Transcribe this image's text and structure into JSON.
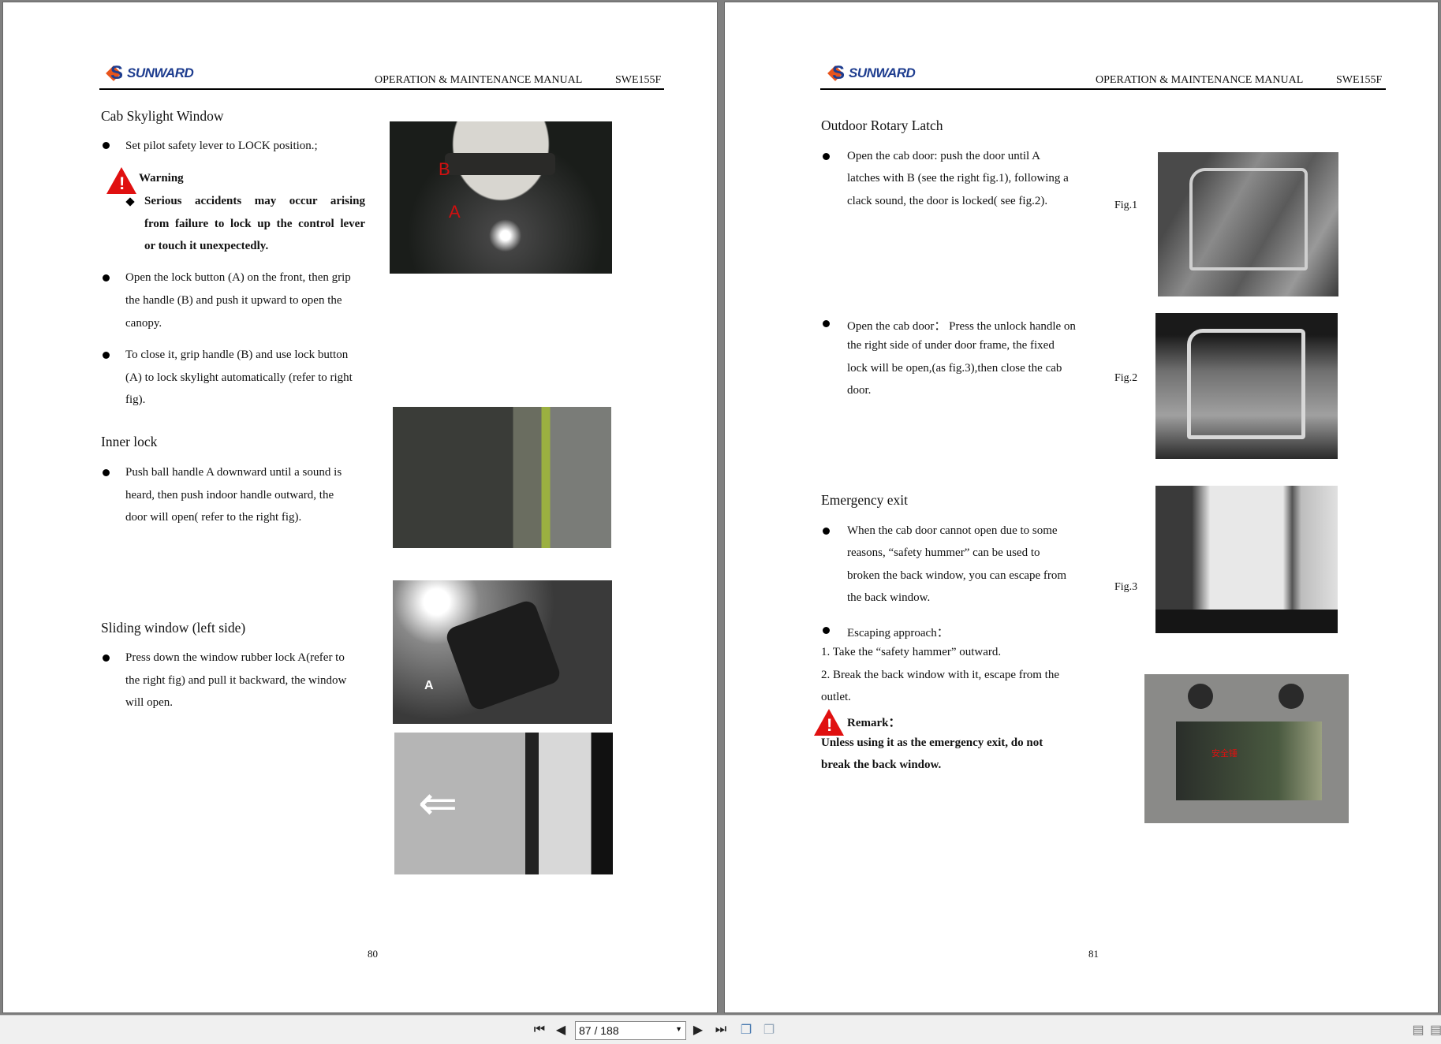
{
  "header": {
    "brand": "SUNWARD",
    "manual": "OPERATION & MAINTENANCE MANUAL",
    "model": "SWE155F"
  },
  "left": {
    "title1": "Cab Skylight Window",
    "b1": "Set pilot safety lever to LOCK position.;",
    "warning": "Warning",
    "warn_lines": [
      "Serious accidents may occur arising",
      "from failure to lock up the control lever",
      "or touch it unexpectedly."
    ],
    "b2": [
      "Open the lock button (A) on the front, then grip",
      "the handle (B) and push it upward to open the",
      "canopy."
    ],
    "b3": [
      "To close it, grip handle (B) and use lock button",
      "(A) to lock skylight automatically (refer to right",
      "fig)."
    ],
    "title2": "Inner lock",
    "b4": [
      "Push ball handle A downward until a sound is",
      "heard, then push indoor handle outward, the",
      "door will open( refer to the right fig)."
    ],
    "title3": "Sliding window (left side)",
    "b5": [
      "Press down the window rubber lock A(refer to",
      "the right fig) and pull it backward, the window",
      "will open."
    ],
    "photo_labels": {
      "a": "A",
      "b": "B"
    },
    "page_number": "80"
  },
  "right": {
    "title1": "Outdoor Rotary Latch",
    "b1": [
      "Open the cab door: push the door until A",
      "latches with B (see the right fig.1), following a",
      "clack sound, the door is locked( see fig.2)."
    ],
    "b2": [
      "Open the cab door： Press the unlock handle on",
      "the right side of under door frame, the fixed",
      "lock will be open,(as fig.3),then close the cab",
      "door."
    ],
    "title2": "Emergency exit",
    "b3": [
      "When the cab door cannot open due to some",
      "reasons, “safety hummer” can be used to",
      "broken the back window, you can escape from",
      "the back window."
    ],
    "b4": "Escaping approach：",
    "step1": "1. Take the “safety hammer” outward.",
    "step2": [
      "2. Break the back window with it, escape from the",
      "outlet."
    ],
    "remark": "Remark：",
    "remark_lines": [
      "Unless using it as the emergency exit, do not",
      "break the back window."
    ],
    "figs": [
      "Fig.1",
      "Fig.2",
      "Fig.3"
    ],
    "photo_label_cn": "安全锤",
    "page_number": "81"
  },
  "toolbar": {
    "page_field": "87 / 188"
  }
}
